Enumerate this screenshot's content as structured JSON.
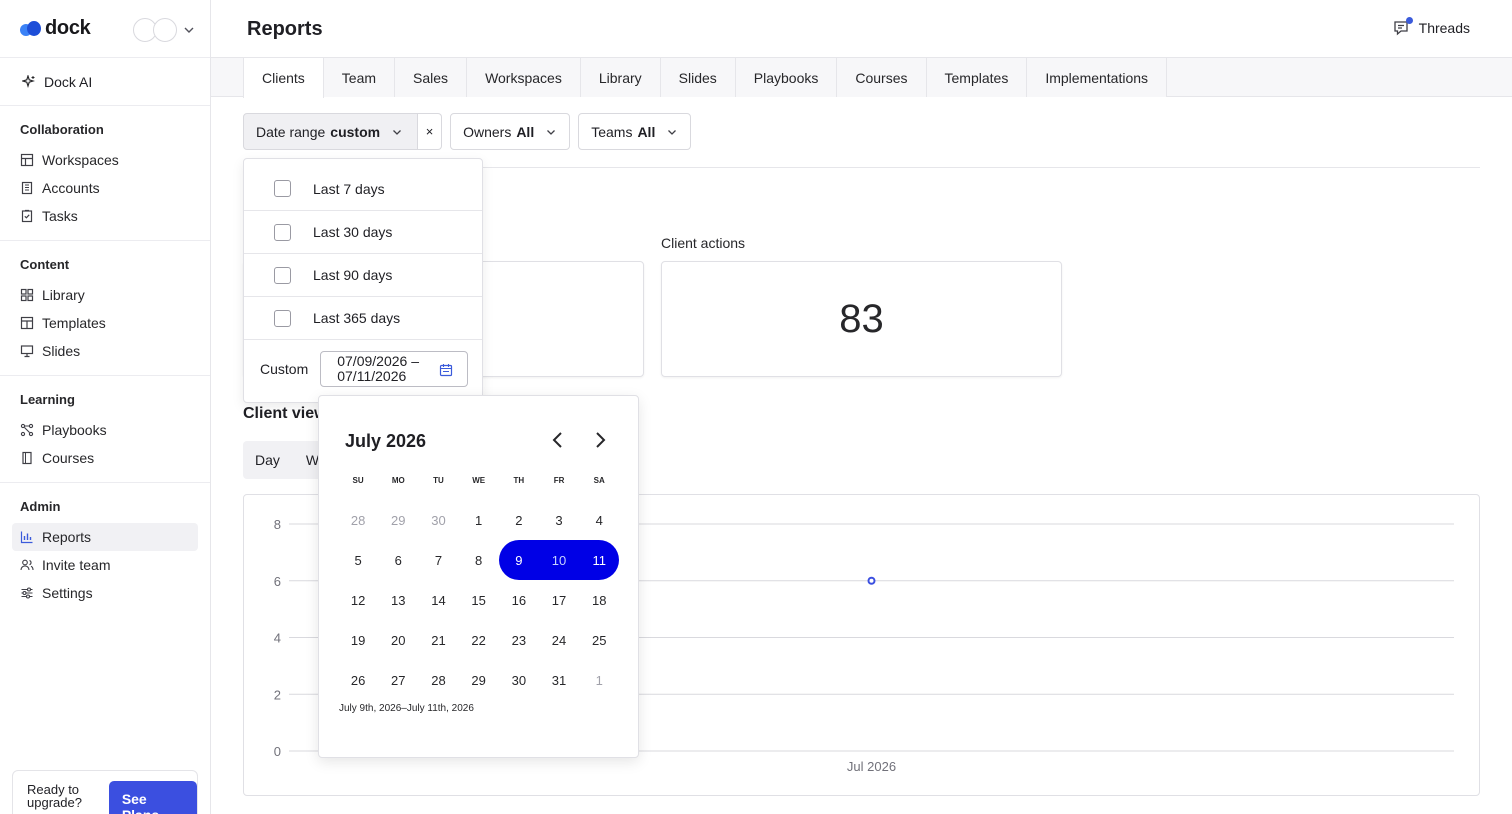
{
  "brand": {
    "name": "dock"
  },
  "sidebar": {
    "ai_label": "Dock AI",
    "sections": [
      {
        "title": "Collaboration",
        "items": [
          {
            "label": "Workspaces"
          },
          {
            "label": "Accounts"
          },
          {
            "label": "Tasks"
          }
        ]
      },
      {
        "title": "Content",
        "items": [
          {
            "label": "Library"
          },
          {
            "label": "Templates"
          },
          {
            "label": "Slides"
          }
        ]
      },
      {
        "title": "Learning",
        "items": [
          {
            "label": "Playbooks"
          },
          {
            "label": "Courses"
          }
        ]
      },
      {
        "title": "Admin",
        "items": [
          {
            "label": "Reports",
            "active": true
          },
          {
            "label": "Invite team"
          },
          {
            "label": "Settings"
          }
        ]
      }
    ],
    "upgrade": {
      "text": "Ready to upgrade?",
      "button": "See Plans"
    }
  },
  "header": {
    "title": "Reports",
    "threads_label": "Threads"
  },
  "tabs": [
    {
      "label": "Clients",
      "active": true
    },
    {
      "label": "Team"
    },
    {
      "label": "Sales"
    },
    {
      "label": "Workspaces"
    },
    {
      "label": "Library"
    },
    {
      "label": "Slides"
    },
    {
      "label": "Playbooks"
    },
    {
      "label": "Courses"
    },
    {
      "label": "Templates"
    },
    {
      "label": "Implementations"
    }
  ],
  "filters": {
    "date_range": {
      "label": "Date range",
      "value": "custom",
      "clear": "×"
    },
    "owners": {
      "label": "Owners",
      "value": "All"
    },
    "teams": {
      "label": "Teams",
      "value": "All"
    }
  },
  "stats": {
    "client_actions": {
      "label": "Client actions",
      "value": "83"
    }
  },
  "client_views": {
    "title": "Client view",
    "granularity": [
      "Day",
      "W"
    ]
  },
  "chart_data": {
    "type": "line",
    "x": [
      "Jul 2026"
    ],
    "series": [
      {
        "values": [
          6
        ]
      }
    ],
    "ylim": [
      0,
      8
    ],
    "yticks": [
      "0",
      "2",
      "4",
      "6",
      "8"
    ],
    "xticks": [
      "Jul 2026"
    ],
    "grid": true,
    "color": "#3b4fe0"
  },
  "date_dropdown": {
    "options": [
      "Last 7 days",
      "Last 30 days",
      "Last 90 days",
      "Last 365 days"
    ],
    "custom_label": "Custom",
    "custom_value_start": "07/09/2026 –",
    "custom_value_end": "07/11/2026"
  },
  "calendar": {
    "month_label": "July 2026",
    "weekdays": [
      "SU",
      "MO",
      "TU",
      "WE",
      "TH",
      "FR",
      "SA"
    ],
    "weeks": [
      [
        "28",
        "29",
        "30",
        "1",
        "2",
        "3",
        "4"
      ],
      [
        "5",
        "6",
        "7",
        "8",
        "9",
        "10",
        "11"
      ],
      [
        "12",
        "13",
        "14",
        "15",
        "16",
        "17",
        "18"
      ],
      [
        "19",
        "20",
        "21",
        "22",
        "23",
        "24",
        "25"
      ],
      [
        "26",
        "27",
        "28",
        "29",
        "30",
        "31",
        "1"
      ]
    ],
    "selected_range": [
      "9",
      "11"
    ],
    "footer": "July 9th, 2026–July 11th, 2026",
    "accent": "#0000e6"
  }
}
